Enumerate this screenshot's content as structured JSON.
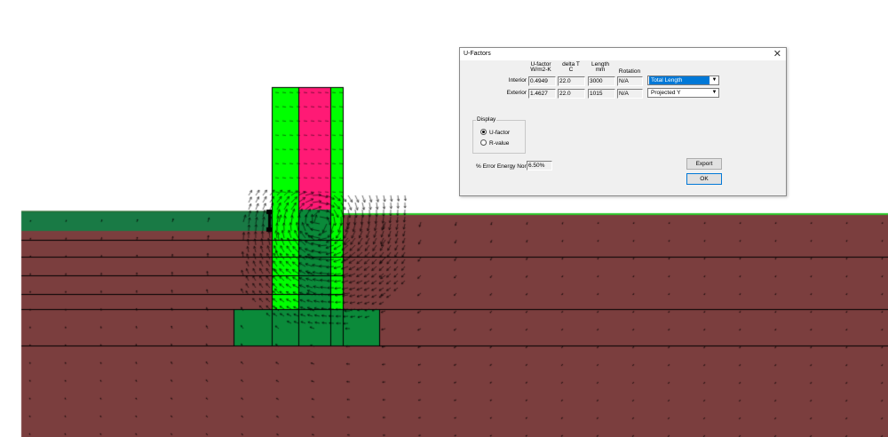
{
  "dialog": {
    "title": "U-Factors",
    "close_glyph": "✕",
    "headers": {
      "ufactor": "U-factor",
      "ufactor_unit": "W/m2-K",
      "deltat": "delta T",
      "deltat_unit": "C",
      "length": "Length",
      "length_unit": "mm",
      "rotation": "Rotation"
    },
    "rows": [
      {
        "label": "Interior",
        "ufactor": "0.4949",
        "deltat": "22.0",
        "length": "3000",
        "rotation": "N/A",
        "mode": "Total Length"
      },
      {
        "label": "Exterior",
        "ufactor": "1.4627",
        "deltat": "22.0",
        "length": "1015",
        "rotation": "N/A",
        "mode": "Projected Y"
      }
    ],
    "display_group": {
      "label": "Display",
      "options": [
        "U-factor",
        "R-value"
      ],
      "selected": "U-factor"
    },
    "error_label": "% Error Energy Norm",
    "error_value": "6.50%",
    "export_label": "Export",
    "ok_label": "OK"
  },
  "icons": {
    "dropdown": "chevron-down-icon",
    "close": "close-icon"
  },
  "colors": {
    "soil": "#7b3e3e",
    "grass": "#197a45",
    "insulation_green": "#00ff00",
    "dark_green": "#0b8a3a",
    "magenta": "#ff1a75",
    "ground_line": "#2bcc2b",
    "arrow": "#000000",
    "selection": "#0078d7"
  }
}
